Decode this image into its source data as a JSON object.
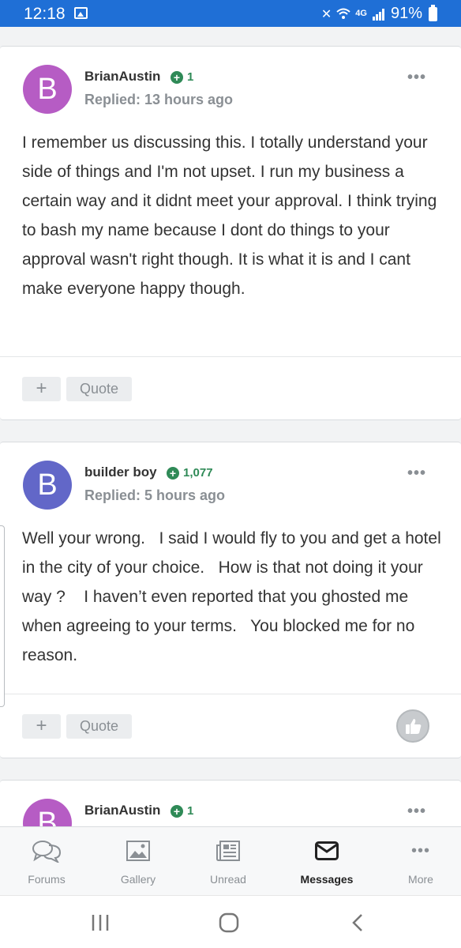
{
  "status_bar": {
    "time": "12:18",
    "network": "4G",
    "battery_percent": "91%",
    "icons": [
      "image-icon",
      "mute-icon",
      "wifi-icon",
      "signal-icon",
      "battery-icon"
    ]
  },
  "posts": [
    {
      "author": "BrianAustin",
      "avatar_letter": "B",
      "avatar_color": "#b65cc4",
      "reputation": "1",
      "replied": "Replied: 13 hours ago",
      "text": "I remember us discussing this. I totally understand your side of things and I'm not upset. I run my business a certain way and it didnt meet your approval. I think trying to bash my name because I dont do things to your approval wasn't right though. It is what it is and I cant make everyone happy though.",
      "quote_label": "Quote",
      "add_label": "+"
    },
    {
      "author": "builder boy",
      "avatar_color": "#6267c8",
      "avatar_letter": "B",
      "reputation": "1,077",
      "replied": "Replied: 5 hours ago",
      "text": "Well your wrong.   I said I would fly to you and get a hotel in the city of your choice.   How is that not doing it your way ?    I haven’t even reported that you ghosted me when agreeing to your terms.   You blocked me for no reason.",
      "quote_label": "Quote",
      "add_label": "+"
    },
    {
      "author": "BrianAustin",
      "avatar_letter": "B",
      "avatar_color": "#b65cc4",
      "reputation": "1"
    }
  ],
  "bottom_nav": [
    {
      "label": "Forums",
      "icon": "forums-icon"
    },
    {
      "label": "Gallery",
      "icon": "gallery-icon"
    },
    {
      "label": "Unread",
      "icon": "unread-icon"
    },
    {
      "label": "Messages",
      "icon": "messages-icon",
      "active": true
    },
    {
      "label": "More",
      "icon": "more-icon"
    }
  ],
  "more_menu_glyph": "•••",
  "colors": {
    "status_bar": "#1f6fd6",
    "reputation_green": "#2f8a57",
    "muted_text": "#8a8f94"
  }
}
